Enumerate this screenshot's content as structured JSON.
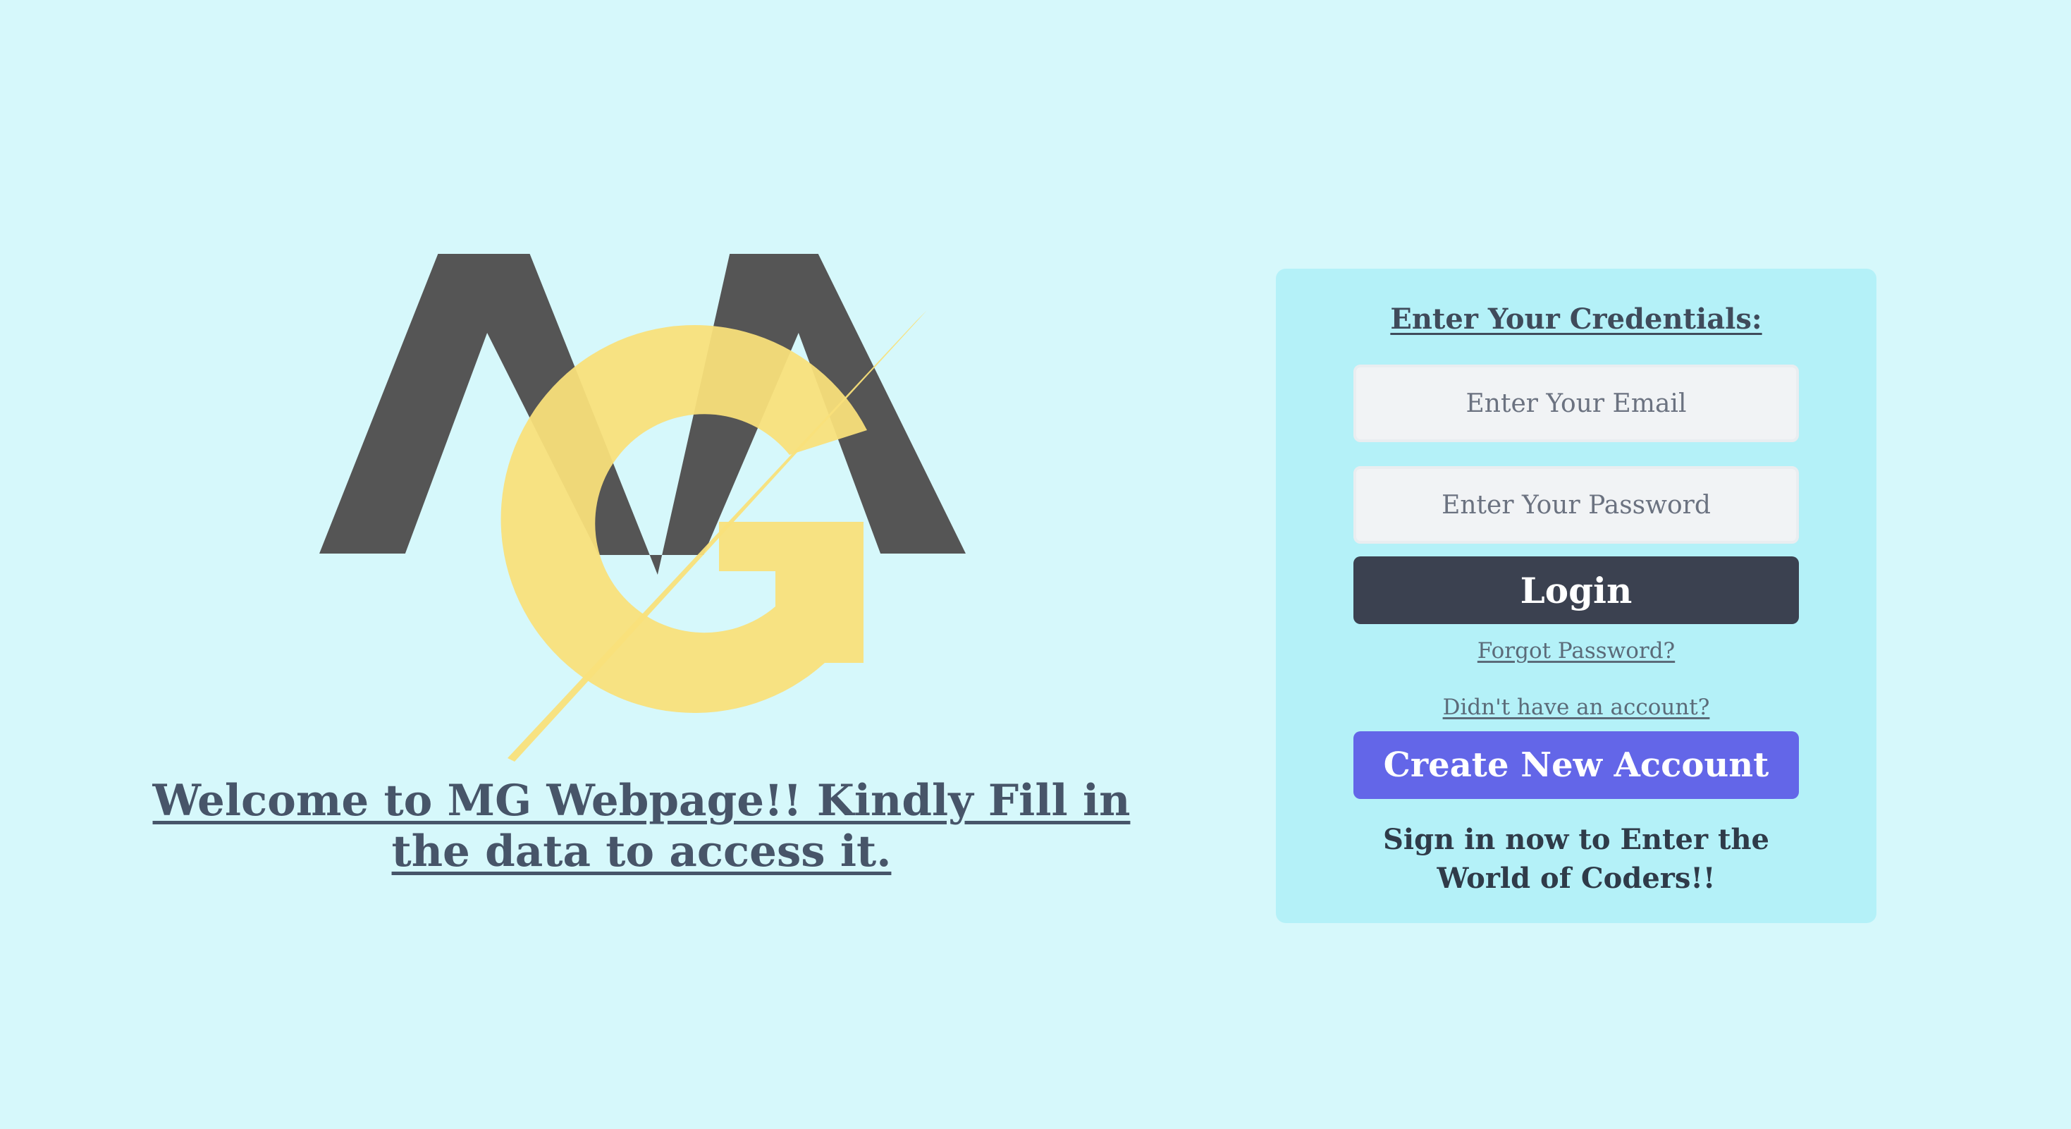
{
  "brand": {
    "logo_colors": {
      "dark": "#555555",
      "accent": "#f9e07a"
    }
  },
  "welcome": {
    "heading": "Welcome to MG Webpage!! Kindly Fill in the data to access it."
  },
  "login_card": {
    "title": "Enter Your Credentials:",
    "email_placeholder": "Enter Your Email",
    "password_placeholder": "Enter Your Password",
    "login_label": "Login",
    "forgot_password_label": "Forgot Password?",
    "no_account_label": "Didn't have an account?",
    "create_account_label": "Create New Account",
    "tagline": "Sign in now to Enter the World of Coders!!"
  },
  "colors": {
    "page_background": "#d6f8fb",
    "card_background": "#b4f1f8",
    "login_button": "#3b4150",
    "create_button": "#6366e8",
    "heading_text": "#475569"
  }
}
